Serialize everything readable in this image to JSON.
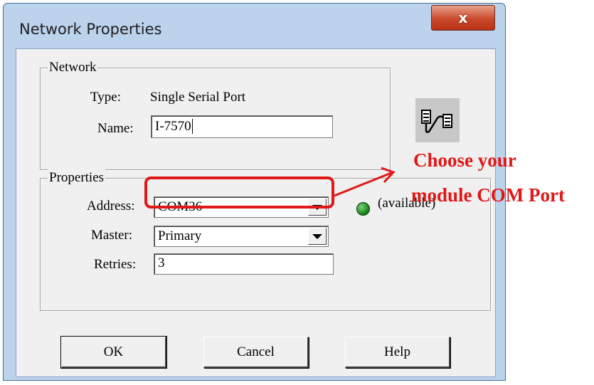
{
  "window": {
    "title": "Network Properties",
    "close_glyph": "x"
  },
  "network_group": {
    "label": "Network",
    "type_label": "Type:",
    "type_value": "Single Serial Port",
    "name_label": "Name:",
    "name_value": "I-7570"
  },
  "properties_group": {
    "label": "Properties",
    "address_label": "Address:",
    "address_value": "COM36",
    "status_text": "(available)",
    "status_color": "#1a8a1a",
    "master_label": "Master:",
    "master_value": "Primary",
    "retries_label": "Retries:",
    "retries_value": "3"
  },
  "buttons": {
    "ok": "OK",
    "cancel": "Cancel",
    "help": "Help"
  },
  "icons": {
    "network": "serial-network-icon",
    "dropdown": "chevron-down-icon"
  },
  "annotation": {
    "line1": "Choose your",
    "line2": "module COM Port",
    "color": "#e01818"
  }
}
